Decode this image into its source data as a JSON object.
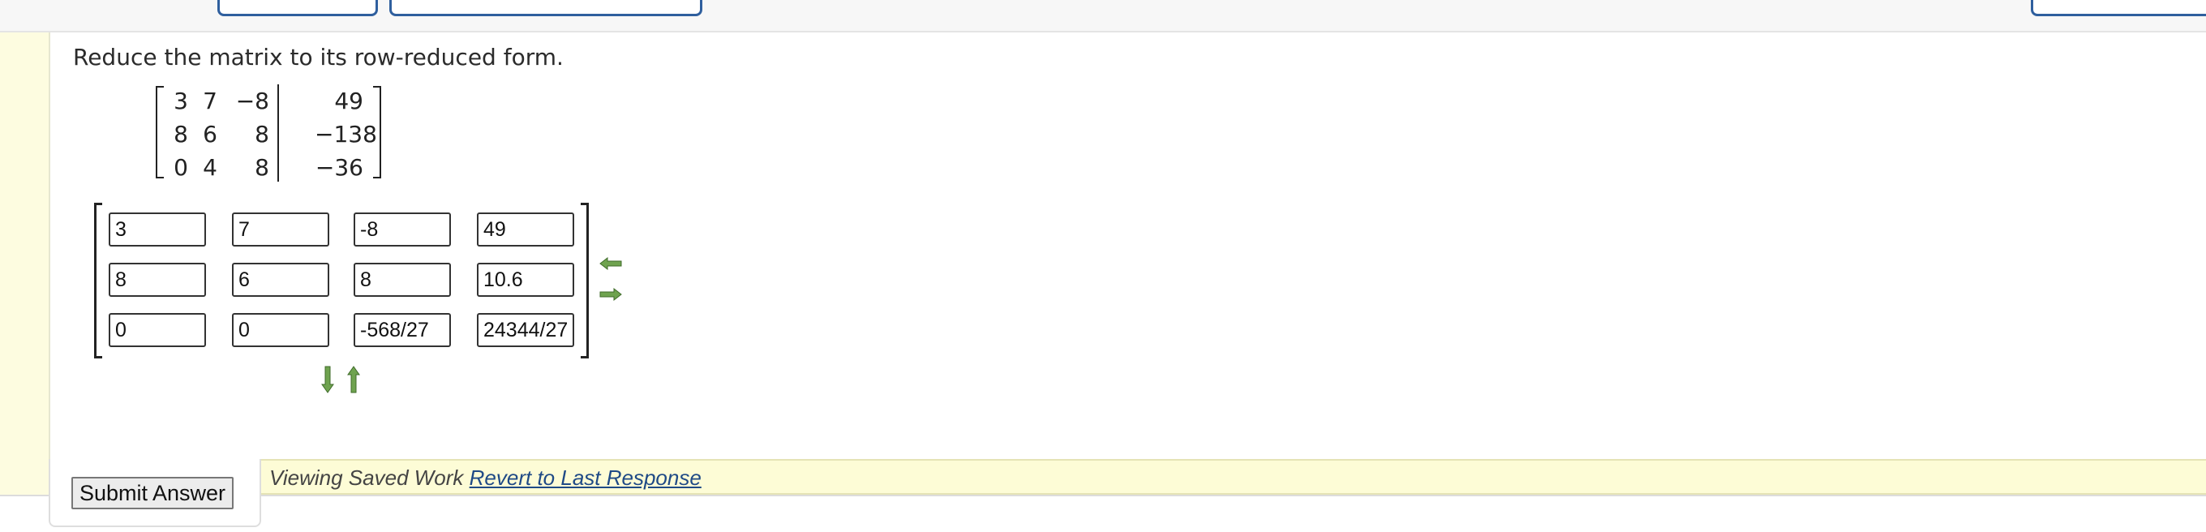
{
  "prompt": "Reduce the matrix to its row-reduced form.",
  "matrix": {
    "rows": [
      [
        "3",
        "7",
        "−8",
        "49"
      ],
      [
        "8",
        "6",
        "8",
        "−138"
      ],
      [
        "0",
        "4",
        "8",
        "−36"
      ]
    ]
  },
  "answer_matrix": {
    "rows": [
      [
        "3",
        "7",
        "-8",
        "49"
      ],
      [
        "8",
        "6",
        "8",
        "10.6"
      ],
      [
        "0",
        "0",
        "-568/27",
        "24344/27"
      ]
    ]
  },
  "controls": {
    "submit_label": "Submit Answer",
    "saved_status": "Viewing Saved Work",
    "revert_link": "Revert to Last Response"
  },
  "icons": {
    "row_left": "left-arrow-icon",
    "row_right": "right-arrow-icon",
    "col_down": "down-arrow-icon",
    "col_up": "up-arrow-icon"
  },
  "colors": {
    "arrow_green": "#6fa34f",
    "highlight_yellow": "#fdfcd6",
    "link_blue": "#1f4a86",
    "button_border_blue": "#2f5f9e"
  }
}
